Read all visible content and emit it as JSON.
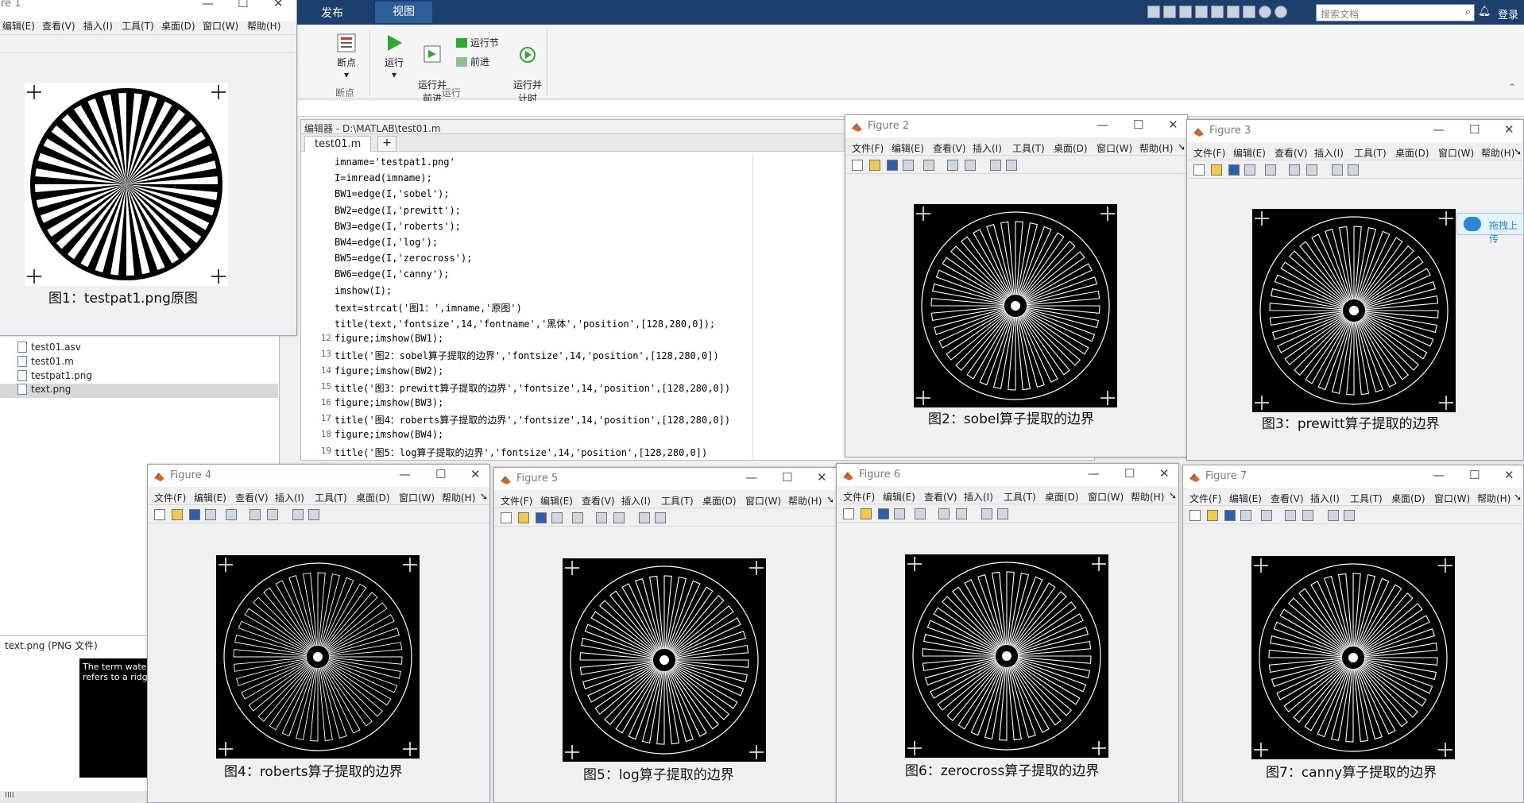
{
  "ribbon": {
    "tabs": [
      "发布",
      "视图"
    ],
    "search_placeholder": "搜索文档",
    "login": "登录",
    "buttons": {
      "breakpoint": "断点",
      "run": "运行",
      "run_advance": "运行并\n前进",
      "run_section": "运行节",
      "advance": "前进",
      "run_time": "运行并\n计时"
    },
    "groups": {
      "breakpoints": "断点",
      "run": "运行"
    }
  },
  "files": {
    "items": [
      "test01.asv",
      "test01.m",
      "testpat1.png",
      "text.png"
    ],
    "selected": "text.png",
    "details_title": "text.png  (PNG 文件)",
    "preview_text": "The term water\nrefers to a ridge"
  },
  "editor": {
    "title": "编辑器 - D:\\MATLAB\\test01.m",
    "tab": "test01.m",
    "add_tab": "+",
    "lines": [
      {
        "n": "",
        "code": "imname='testpat1.png'"
      },
      {
        "n": "",
        "code": "I=imread(imname);"
      },
      {
        "n": "",
        "code": "BW1=edge(I,'sobel');"
      },
      {
        "n": "",
        "code": "BW2=edge(I,'prewitt');"
      },
      {
        "n": "",
        "code": "BW3=edge(I,'roberts');"
      },
      {
        "n": "",
        "code": "BW4=edge(I,'log');"
      },
      {
        "n": "",
        "code": "BW5=edge(I,'zerocross');"
      },
      {
        "n": "",
        "code": "BW6=edge(I,'canny');"
      },
      {
        "n": "",
        "code": "imshow(I);"
      },
      {
        "n": "",
        "code": "text=strcat('图1：',imname,'原图')"
      },
      {
        "n": "",
        "code": "title(text,'fontsize',14,'fontname','黑体','position',[128,280,0]);"
      },
      {
        "n": "12",
        "code": "figure;imshow(BW1);"
      },
      {
        "n": "13",
        "code": "title('图2：sobel算子提取的边界','fontsize',14,'position',[128,280,0])"
      },
      {
        "n": "14",
        "code": "figure;imshow(BW2);"
      },
      {
        "n": "15",
        "code": "title('图3：prewitt算子提取的边界','fontsize',14,'position',[128,280,0])"
      },
      {
        "n": "16",
        "code": "figure;imshow(BW3);"
      },
      {
        "n": "17",
        "code": "title('图4：roberts算子提取的边界','fontsize',14,'position',[128,280,0])"
      },
      {
        "n": "18",
        "code": "figure;imshow(BW4);"
      },
      {
        "n": "19",
        "code": "title('图5：log算子提取的边界','fontsize',14,'position',[128,280,0])"
      }
    ]
  },
  "figure_menu": [
    "文件(F)",
    "编辑(E)",
    "查看(V)",
    "插入(I)",
    "工具(T)",
    "桌面(D)",
    "窗口(W)",
    "帮助(H)"
  ],
  "fig1_menu": [
    "编辑(E)",
    "查看(V)",
    "插入(I)",
    "工具(T)",
    "桌面(D)",
    "窗口(W)",
    "帮助(H)"
  ],
  "figures": {
    "fig1": {
      "title": "re 1",
      "caption": "图1：testpat1.png原图"
    },
    "fig2": {
      "title": "Figure 2",
      "caption": "图2：sobel算子提取的边界"
    },
    "fig3": {
      "title": "Figure 3",
      "caption": "图3：prewitt算子提取的边界"
    },
    "fig4": {
      "title": "Figure 4",
      "caption": "图4：roberts算子提取的边界"
    },
    "fig5": {
      "title": "Figure 5",
      "caption": "图5：log算子提取的边界"
    },
    "fig6": {
      "title": "Figure 6",
      "caption": "图6：zerocross算子提取的边界"
    },
    "fig7": {
      "title": "Figure 7",
      "caption": "图7：canny算子提取的边界"
    }
  },
  "float_button": "拖拽上传",
  "colors": {
    "ribbon_bg": "#1c3f6e",
    "string_purple": "#a020f0"
  }
}
